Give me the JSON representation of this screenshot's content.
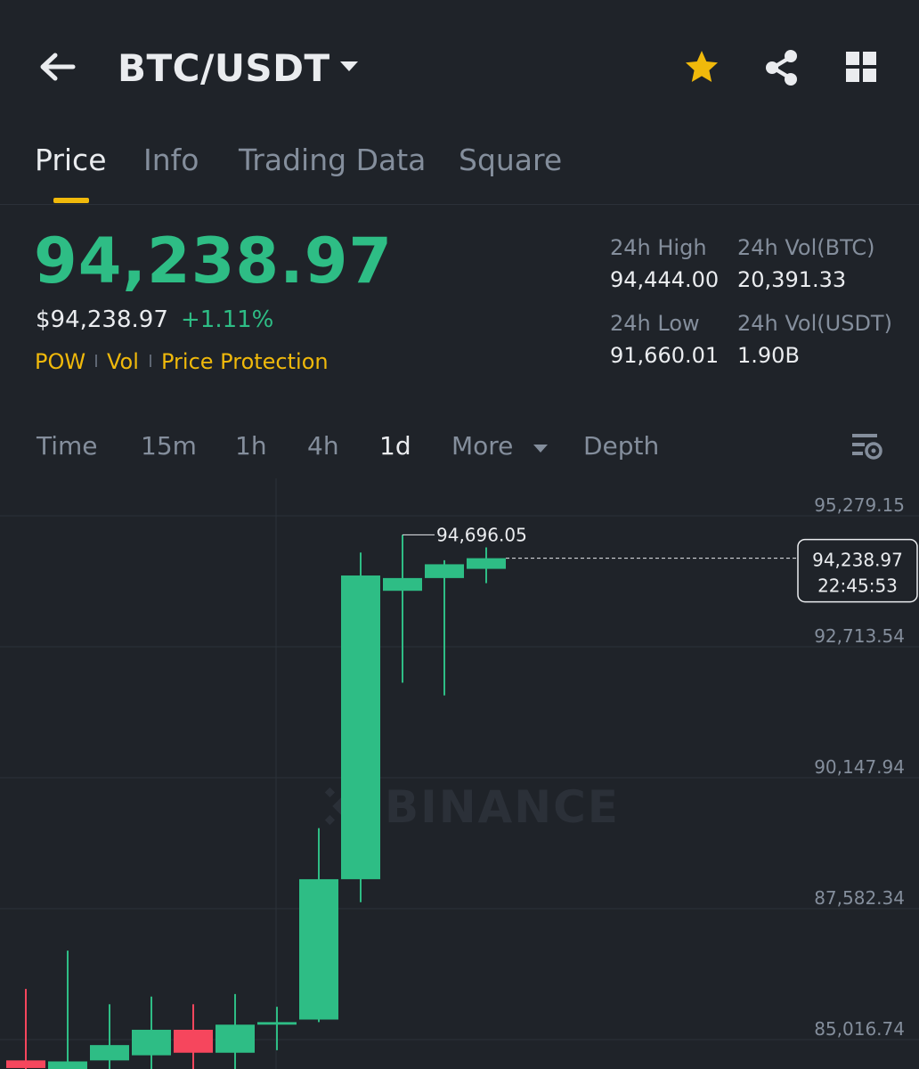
{
  "header": {
    "pair": "BTC/USDT",
    "icons": [
      "back-arrow-icon",
      "dropdown-caret-icon",
      "star-icon",
      "share-icon",
      "grid-icon"
    ],
    "star_color": "#f0b90b"
  },
  "tabs": [
    {
      "label": "Price",
      "active": true
    },
    {
      "label": "Info",
      "active": false
    },
    {
      "label": "Trading Data",
      "active": false
    },
    {
      "label": "Square",
      "active": false
    }
  ],
  "price": {
    "last": "94,238.97",
    "fiat": "$94,238.97",
    "change": "+1.11%",
    "tags": [
      "POW",
      "Vol",
      "Price Protection"
    ]
  },
  "stats": {
    "high_label": "24h High",
    "high_value": "94,444.00",
    "vol_btc_label": "24h Vol(BTC)",
    "vol_btc_value": "20,391.33",
    "low_label": "24h Low",
    "low_value": "91,660.01",
    "vol_usdt_label": "24h Vol(USDT)",
    "vol_usdt_value": "1.90B"
  },
  "timeframes": {
    "items": [
      "Time",
      "15m",
      "1h",
      "4h",
      "1d"
    ],
    "active": "1d",
    "more": "More",
    "depth": "Depth"
  },
  "colors": {
    "up": "#2ebd85",
    "down": "#f6465d",
    "accent": "#f0b90b",
    "background": "#1f2329"
  },
  "chart_data": {
    "type": "candlestick",
    "interval": "1d",
    "y_ticks": [
      "95,279.15",
      "92,713.54",
      "90,147.94",
      "87,582.34",
      "85,016.74"
    ],
    "y_tick_values": [
      95279.15,
      92713.54,
      90147.94,
      87582.34,
      85016.74
    ],
    "grid": true,
    "watermark": "BINANCE",
    "high_label": "94,696.05",
    "current_price": "94,238.97",
    "current_price_value": 94238.97,
    "countdown": "22:45:53",
    "candles": [
      {
        "open": 84400,
        "close": 84250,
        "high": 85800,
        "low": 84000
      },
      {
        "open": 84200,
        "close": 84380,
        "high": 86550,
        "low": 84000
      },
      {
        "open": 84400,
        "close": 84700,
        "high": 85500,
        "low": 84000
      },
      {
        "open": 84500,
        "close": 85000,
        "high": 85650,
        "low": 84000
      },
      {
        "open": 85000,
        "close": 84550,
        "high": 85500,
        "low": 84000
      },
      {
        "open": 84550,
        "close": 85100,
        "high": 85700,
        "low": 84000
      },
      {
        "open": 85100,
        "close": 85150,
        "high": 85450,
        "low": 84600
      },
      {
        "open": 85200,
        "close": 87950,
        "high": 88950,
        "low": 85150
      },
      {
        "open": 87950,
        "close": 93900,
        "high": 94350,
        "low": 87500
      },
      {
        "open": 93600,
        "close": 93850,
        "high": 94696.05,
        "low": 91800
      },
      {
        "open": 93850,
        "close": 94120,
        "high": 94200,
        "low": 91550
      },
      {
        "open": 94030,
        "close": 94238.97,
        "high": 94450,
        "low": 93750
      }
    ]
  }
}
